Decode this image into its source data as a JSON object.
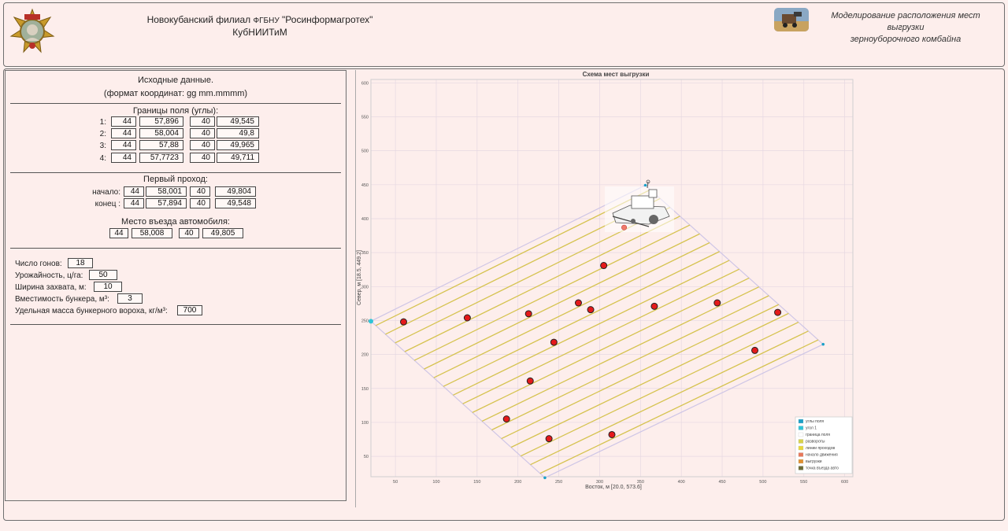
{
  "header": {
    "org_line1_a": "Новокубанский филиал",
    "org_line1_b": "ФГБНУ",
    "org_line1_c": "\"Росинформагротех\"",
    "org_line2": "КубНИИТиМ",
    "app_title_line1": "Моделирование расположения мест выгрузки",
    "app_title_line2": "зерноуборочного комбайна"
  },
  "inputs": {
    "section_title": "Исходные данные.",
    "format_hint": "(формат координат: gg  mm.mmmm)",
    "field_bounds_title": "Границы поля (углы):",
    "corners": [
      {
        "label": "1:",
        "lat_deg": "44",
        "lat_min": "57,896",
        "lon_deg": "40",
        "lon_min": "49,545"
      },
      {
        "label": "2:",
        "lat_deg": "44",
        "lat_min": "58,004",
        "lon_deg": "40",
        "lon_min": "49,8"
      },
      {
        "label": "3:",
        "lat_deg": "44",
        "lat_min": "57,88",
        "lon_deg": "40",
        "lon_min": "49,965"
      },
      {
        "label": "4:",
        "lat_deg": "44",
        "lat_min": "57,7723",
        "lon_deg": "40",
        "lon_min": "49,711"
      }
    ],
    "first_pass_title": "Первый проход:",
    "first_pass": [
      {
        "label": "начало:",
        "lat_deg": "44",
        "lat_min": "58,001",
        "lon_deg": "40",
        "lon_min": "49,804"
      },
      {
        "label": "конец  :",
        "lat_deg": "44",
        "lat_min": "57,894",
        "lon_deg": "40",
        "lon_min": "49,548"
      }
    ],
    "exit_title": "Место въезда автомобиля:",
    "exit": {
      "lat_deg": "44",
      "lat_min": "58,008",
      "lon_deg": "40",
      "lon_min": "49,805"
    },
    "params": [
      {
        "label": "Число гонов:",
        "value": "18"
      },
      {
        "label": "Урожайность, ц/га:",
        "value": "50"
      },
      {
        "label": "Ширина захвата, м:",
        "value": "10"
      },
      {
        "label": "Вместимость бункера, м³:",
        "value": "3"
      },
      {
        "label": "Удельная масса бункерного вороха, кг/м³:",
        "value": "700"
      }
    ]
  },
  "chart_data": {
    "type": "scatter",
    "title": "Схема мест выгрузки",
    "xlabel": "Восток, м  [20.0, 573.6]",
    "ylabel": "Север, м  [18.5, 449.2]",
    "xlim": [
      20,
      610
    ],
    "ylim": [
      20,
      605
    ],
    "xticks": [
      50,
      100,
      150,
      200,
      250,
      300,
      350,
      400,
      450,
      500,
      550,
      600
    ],
    "yticks": [
      50,
      100,
      150,
      200,
      250,
      300,
      350,
      400,
      450,
      500,
      550,
      600
    ],
    "grid": true,
    "field_corners": [
      [
        20,
        249
      ],
      [
        233,
        18.5
      ],
      [
        573.6,
        215
      ],
      [
        356,
        449.2
      ]
    ],
    "pass_count": 18,
    "unload_points": [
      [
        60,
        248
      ],
      [
        138,
        254
      ],
      [
        213,
        260
      ],
      [
        305,
        331
      ],
      [
        274,
        276
      ],
      [
        289,
        266
      ],
      [
        367,
        271
      ],
      [
        444,
        276
      ],
      [
        518,
        262
      ],
      [
        244,
        218
      ],
      [
        490,
        206
      ],
      [
        215,
        161
      ],
      [
        186,
        105
      ],
      [
        238,
        76
      ],
      [
        315,
        82
      ]
    ],
    "start_point": [
      330,
      387
    ],
    "legend": [
      {
        "name": "углы поля",
        "color": "#1aa0c8"
      },
      {
        "name": "угол 1",
        "color": "#2ec4d8"
      },
      {
        "name": "граница поля",
        "color": "#ffffff"
      },
      {
        "name": "развороты",
        "color": "#d8d24a"
      },
      {
        "name": "линии проходов",
        "color": "#e8d83a"
      },
      {
        "name": "начало движения",
        "color": "#e8785a"
      },
      {
        "name": "выгрузки",
        "color": "#e09030"
      },
      {
        "name": "точка въезда авто",
        "color": "#6b6b35"
      }
    ],
    "legend_position": "bottom-right"
  }
}
